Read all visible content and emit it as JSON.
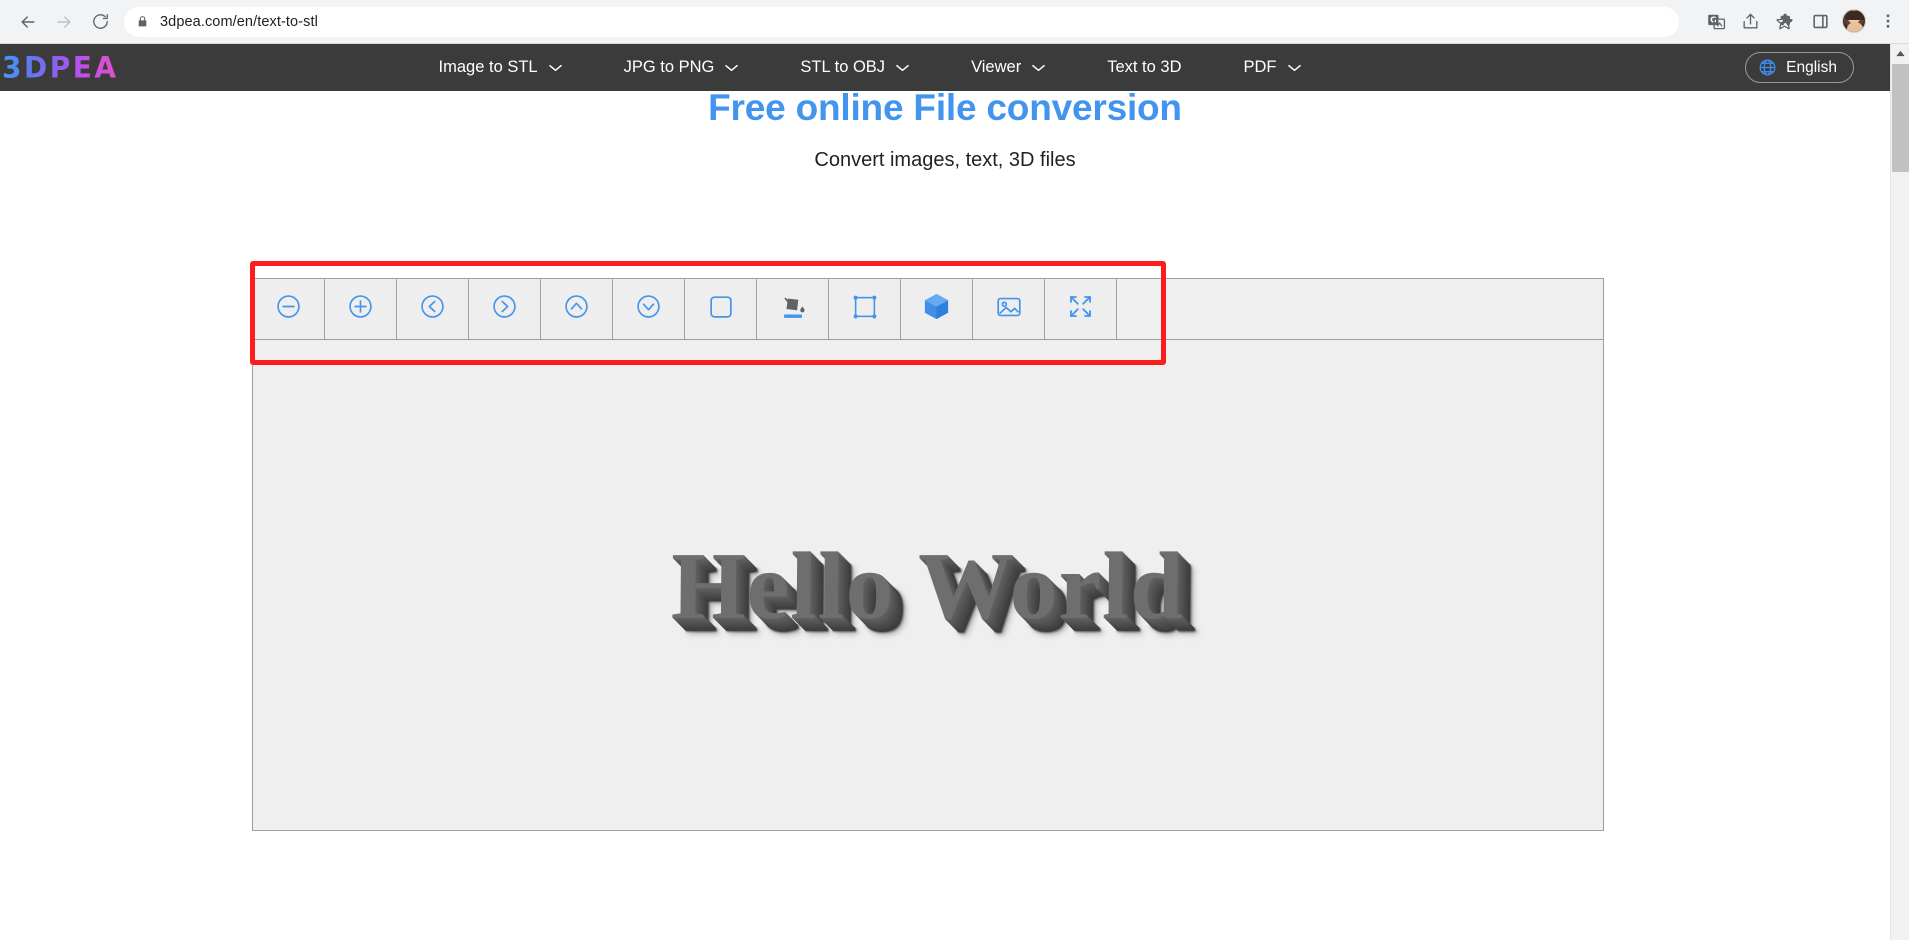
{
  "browser": {
    "back_label": "Back",
    "forward_label": "Forward",
    "reload_label": "Reload",
    "url": "3dpea.com/en/text-to-stl",
    "lock_icon": "lock-icon",
    "actions": [
      {
        "name": "translate-icon",
        "label": "Translate this page"
      },
      {
        "name": "share-icon",
        "label": "Share this page"
      },
      {
        "name": "bookmark-star-icon",
        "label": "Bookmark this tab"
      },
      {
        "name": "extensions-puzzle-icon",
        "label": "Extensions"
      },
      {
        "name": "side-panel-icon",
        "label": "Side panel"
      },
      {
        "name": "profile-avatar",
        "label": "Profile"
      },
      {
        "name": "chrome-menu-icon",
        "label": "Customize and control Google Chrome"
      }
    ]
  },
  "site": {
    "logo_text": "3DPEA",
    "nav": [
      {
        "label": "Image to STL",
        "has_dropdown": true
      },
      {
        "label": "JPG to PNG",
        "has_dropdown": true
      },
      {
        "label": "STL to OBJ",
        "has_dropdown": true
      },
      {
        "label": "Viewer",
        "has_dropdown": true
      },
      {
        "label": "Text to 3D",
        "has_dropdown": false
      },
      {
        "label": "PDF",
        "has_dropdown": true
      }
    ],
    "language": {
      "label": "English",
      "icon": "globe-icon"
    },
    "header_bg": "#3b3b3b"
  },
  "hero": {
    "title": "Free online File conversion",
    "title_color": "#4294ef",
    "subtitle": "Convert images, text, 3D files"
  },
  "editor": {
    "toolbar": [
      {
        "name": "zoom-out-icon",
        "label": "Zoom out"
      },
      {
        "name": "zoom-in-icon",
        "label": "Zoom in"
      },
      {
        "name": "move-left-icon",
        "label": "Move left"
      },
      {
        "name": "move-right-icon",
        "label": "Move right"
      },
      {
        "name": "move-up-icon",
        "label": "Move up"
      },
      {
        "name": "move-down-icon",
        "label": "Move down"
      },
      {
        "name": "square-shape-icon",
        "label": "Shape"
      },
      {
        "name": "paint-bucket-icon",
        "label": "Fill color"
      },
      {
        "name": "transform-frame-icon",
        "label": "Transform"
      },
      {
        "name": "cube-3d-icon",
        "label": "3D view"
      },
      {
        "name": "image-icon",
        "label": "Image"
      },
      {
        "name": "fullscreen-icon",
        "label": "Fullscreen"
      }
    ],
    "canvas": {
      "preview_text": "Hello World"
    },
    "accent_color": "#4294ef"
  },
  "annotation": {
    "color": "#fc1d1d",
    "target": "editor-toolbar"
  }
}
